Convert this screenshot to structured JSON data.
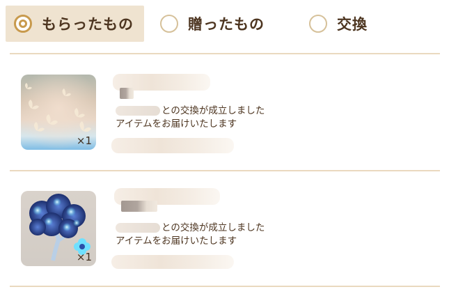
{
  "tabs": [
    {
      "label": "もらったもの",
      "active": true
    },
    {
      "label": "贈ったもの",
      "active": false
    },
    {
      "label": "交換",
      "active": false
    }
  ],
  "items": [
    {
      "message_line1": "との交換が成立しました",
      "message_line2": "アイテムをお届けいたします",
      "quantity": "×1",
      "thumbnail_icon": "butterfly-item-icon"
    },
    {
      "message_line1": "との交換が成立しました",
      "message_line2": "アイテムをお届けいたします",
      "quantity": "×1",
      "thumbnail_icon": "blue-flower-tree-item-icon"
    }
  ],
  "colors": {
    "accent": "#c89a4d",
    "active_tab_bg": "#efe3d0",
    "divider": "#ead9bf",
    "text": "#4d3520"
  }
}
